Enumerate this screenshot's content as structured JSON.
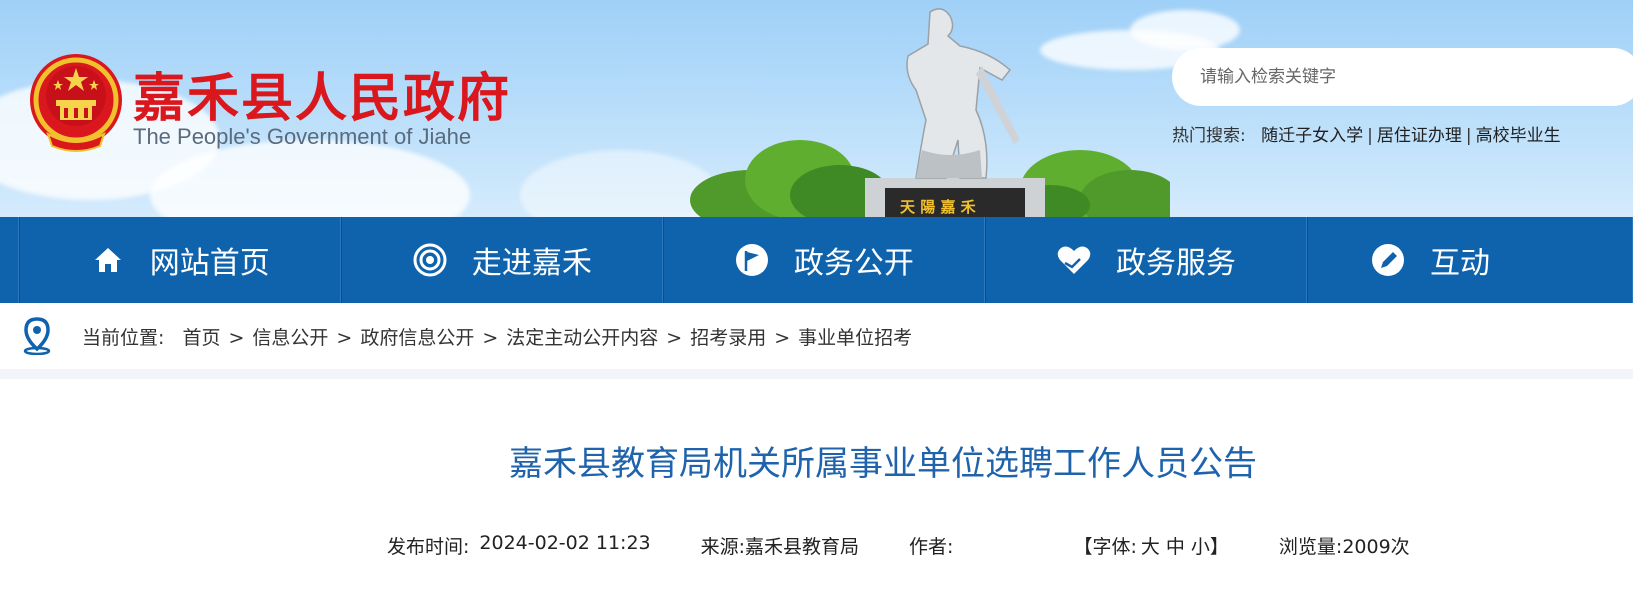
{
  "header": {
    "title": "嘉禾县人民政府",
    "subtitle": "The People's Government of Jiahe",
    "monument_text": "天 陽 嘉 禾",
    "colors": {
      "title_red": "#d9171c",
      "nav_blue": "#0f63ad",
      "article_title_blue": "#1e63ab"
    }
  },
  "search": {
    "placeholder": "请输入检索关键字",
    "hot_label": "热门搜索:",
    "hot_items": [
      "随迁子女入学",
      "居住证办理",
      "高校毕业生"
    ]
  },
  "nav": {
    "items": [
      {
        "label": "网站首页",
        "icon": "home-icon"
      },
      {
        "label": "走进嘉禾",
        "icon": "target-icon"
      },
      {
        "label": "政务公开",
        "icon": "flag-icon"
      },
      {
        "label": "政务服务",
        "icon": "heart-hand-icon"
      },
      {
        "label": "互动",
        "icon": "pen-icon"
      }
    ]
  },
  "breadcrumb": {
    "label": "当前位置:",
    "items": [
      "首页",
      "信息公开",
      "政府信息公开",
      "法定主动公开内容",
      "招考录用",
      "事业单位招考"
    ],
    "separator": ">"
  },
  "article": {
    "title": "嘉禾县教育局机关所属事业单位选聘工作人员公告",
    "publish_label": "发布时间:",
    "publish_time": "2024-02-02 11:23",
    "source_label": "来源:",
    "source": "嘉禾县教育局",
    "author_label": "作者:",
    "author": "",
    "font_open": "【字体:",
    "font_large": "大",
    "font_medium": "中",
    "font_small": "小",
    "font_close": "】",
    "views_label": "浏览量:",
    "views": "2009次"
  }
}
